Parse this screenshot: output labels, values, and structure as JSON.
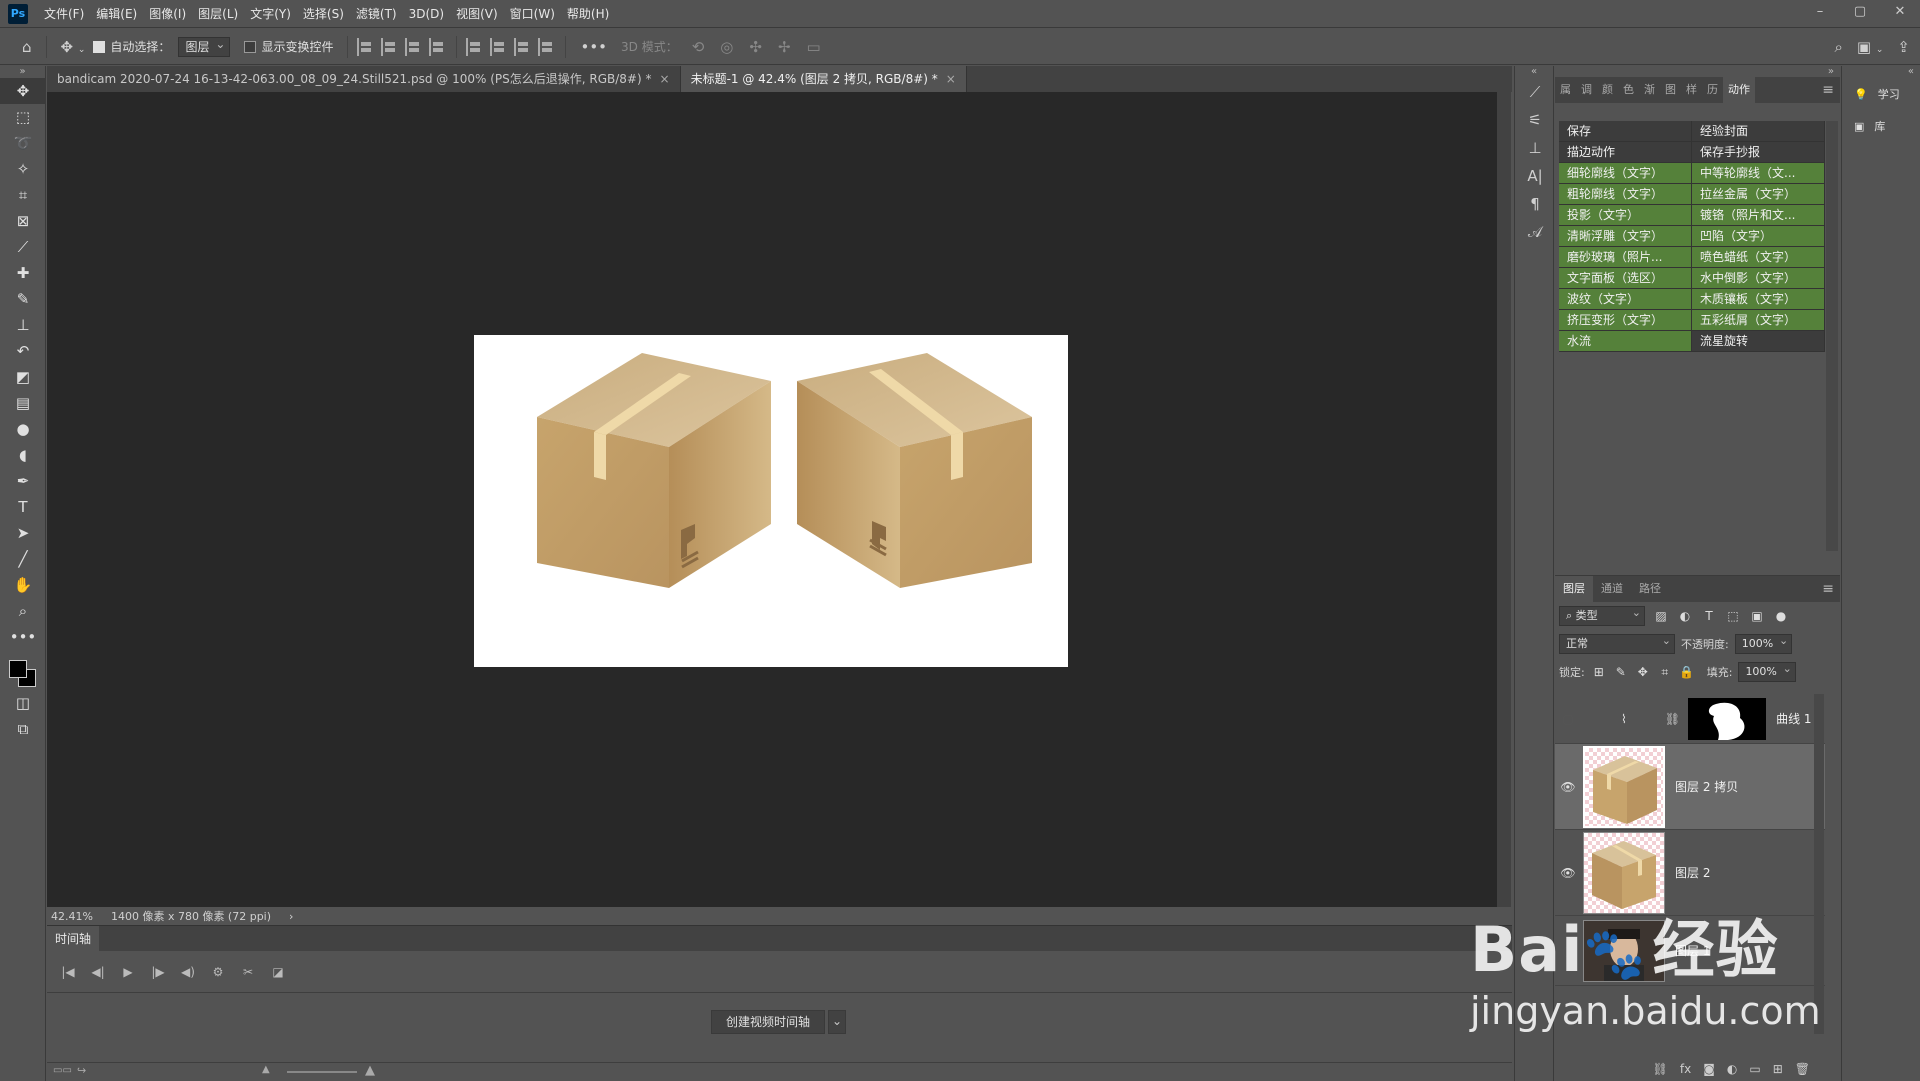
{
  "app": {
    "logo": "Ps"
  },
  "menu": [
    "文件(F)",
    "编辑(E)",
    "图像(I)",
    "图层(L)",
    "文字(Y)",
    "选择(S)",
    "滤镜(T)",
    "3D(D)",
    "视图(V)",
    "窗口(W)",
    "帮助(H)"
  ],
  "options": {
    "auto_select_label": "自动选择：",
    "auto_select_target": "图层",
    "show_transform_label": "显示变换控件",
    "mode_3d_label": "3D 模式："
  },
  "tabs": [
    {
      "label": "bandicam 2020-07-24 16-13-42-063.00_08_09_24.Still521.psd @ 100% (PS怎么后退操作, RGB/8#) *",
      "close": "×"
    },
    {
      "label": "未标题-1 @ 42.4% (图层 2 拷贝, RGB/8#) *",
      "close": "×"
    }
  ],
  "status": {
    "zoom": "42.41%",
    "doc_size": "1400 像素 x 780 像素 (72 ppi)",
    "arrow": "›"
  },
  "timeline": {
    "tab": "时间轴",
    "create_button": "创建视频时间轴"
  },
  "panel_tabs": [
    "属",
    "调",
    "颜",
    "色",
    "渐",
    "图",
    "样",
    "历",
    "动作"
  ],
  "actions": [
    {
      "label": "保存",
      "style": "gray"
    },
    {
      "label": "经验封面",
      "style": "gray"
    },
    {
      "label": "描边动作",
      "style": "gray"
    },
    {
      "label": "保存手抄报",
      "style": "gray"
    },
    {
      "label": "细轮廓线（文字）",
      "style": "green"
    },
    {
      "label": "中等轮廓线（文...",
      "style": "green"
    },
    {
      "label": "粗轮廓线（文字）",
      "style": "green"
    },
    {
      "label": "拉丝金属（文字）",
      "style": "green"
    },
    {
      "label": "投影（文字）",
      "style": "green"
    },
    {
      "label": "镀铬（照片和文...",
      "style": "green"
    },
    {
      "label": "清晰浮雕（文字）",
      "style": "green"
    },
    {
      "label": "凹陷（文字）",
      "style": "green"
    },
    {
      "label": "磨砂玻璃（照片...",
      "style": "green"
    },
    {
      "label": "喷色蜡纸（文字）",
      "style": "green"
    },
    {
      "label": "文字面板（选区）",
      "style": "green"
    },
    {
      "label": "水中倒影（文字）",
      "style": "green"
    },
    {
      "label": "波纹（文字）",
      "style": "green"
    },
    {
      "label": "木质镶板（文字）",
      "style": "green"
    },
    {
      "label": "挤压变形（文字）",
      "style": "green"
    },
    {
      "label": "五彩纸屑（文字）",
      "style": "green"
    },
    {
      "label": "水流",
      "style": "green"
    },
    {
      "label": "流星旋转",
      "style": "gray"
    }
  ],
  "layers_panel": {
    "tabs": [
      "图层",
      "通道",
      "路径"
    ],
    "filter_type": "类型",
    "blend_mode": "正常",
    "opacity_label": "不透明度:",
    "opacity": "100%",
    "lock_label": "锁定:",
    "fill_label": "填充:",
    "fill": "100%",
    "layers": [
      {
        "name": "曲线 1",
        "visible": false,
        "kind": "adjustment"
      },
      {
        "name": "图层 2 拷贝",
        "visible": true,
        "kind": "box-left",
        "selected": true
      },
      {
        "name": "图层 2",
        "visible": true,
        "kind": "box-right"
      },
      {
        "name": "图层 1",
        "visible": false,
        "kind": "photo"
      }
    ]
  },
  "far_right": {
    "learn": "学习",
    "library": "库"
  },
  "watermark": {
    "brand": "Bai",
    "jingyan": "经验",
    "url": "jingyan.baidu.com"
  },
  "colors": {
    "accent_green": "#55813a",
    "box_tan": "#c9a874",
    "canvas_bg": "#282828"
  }
}
